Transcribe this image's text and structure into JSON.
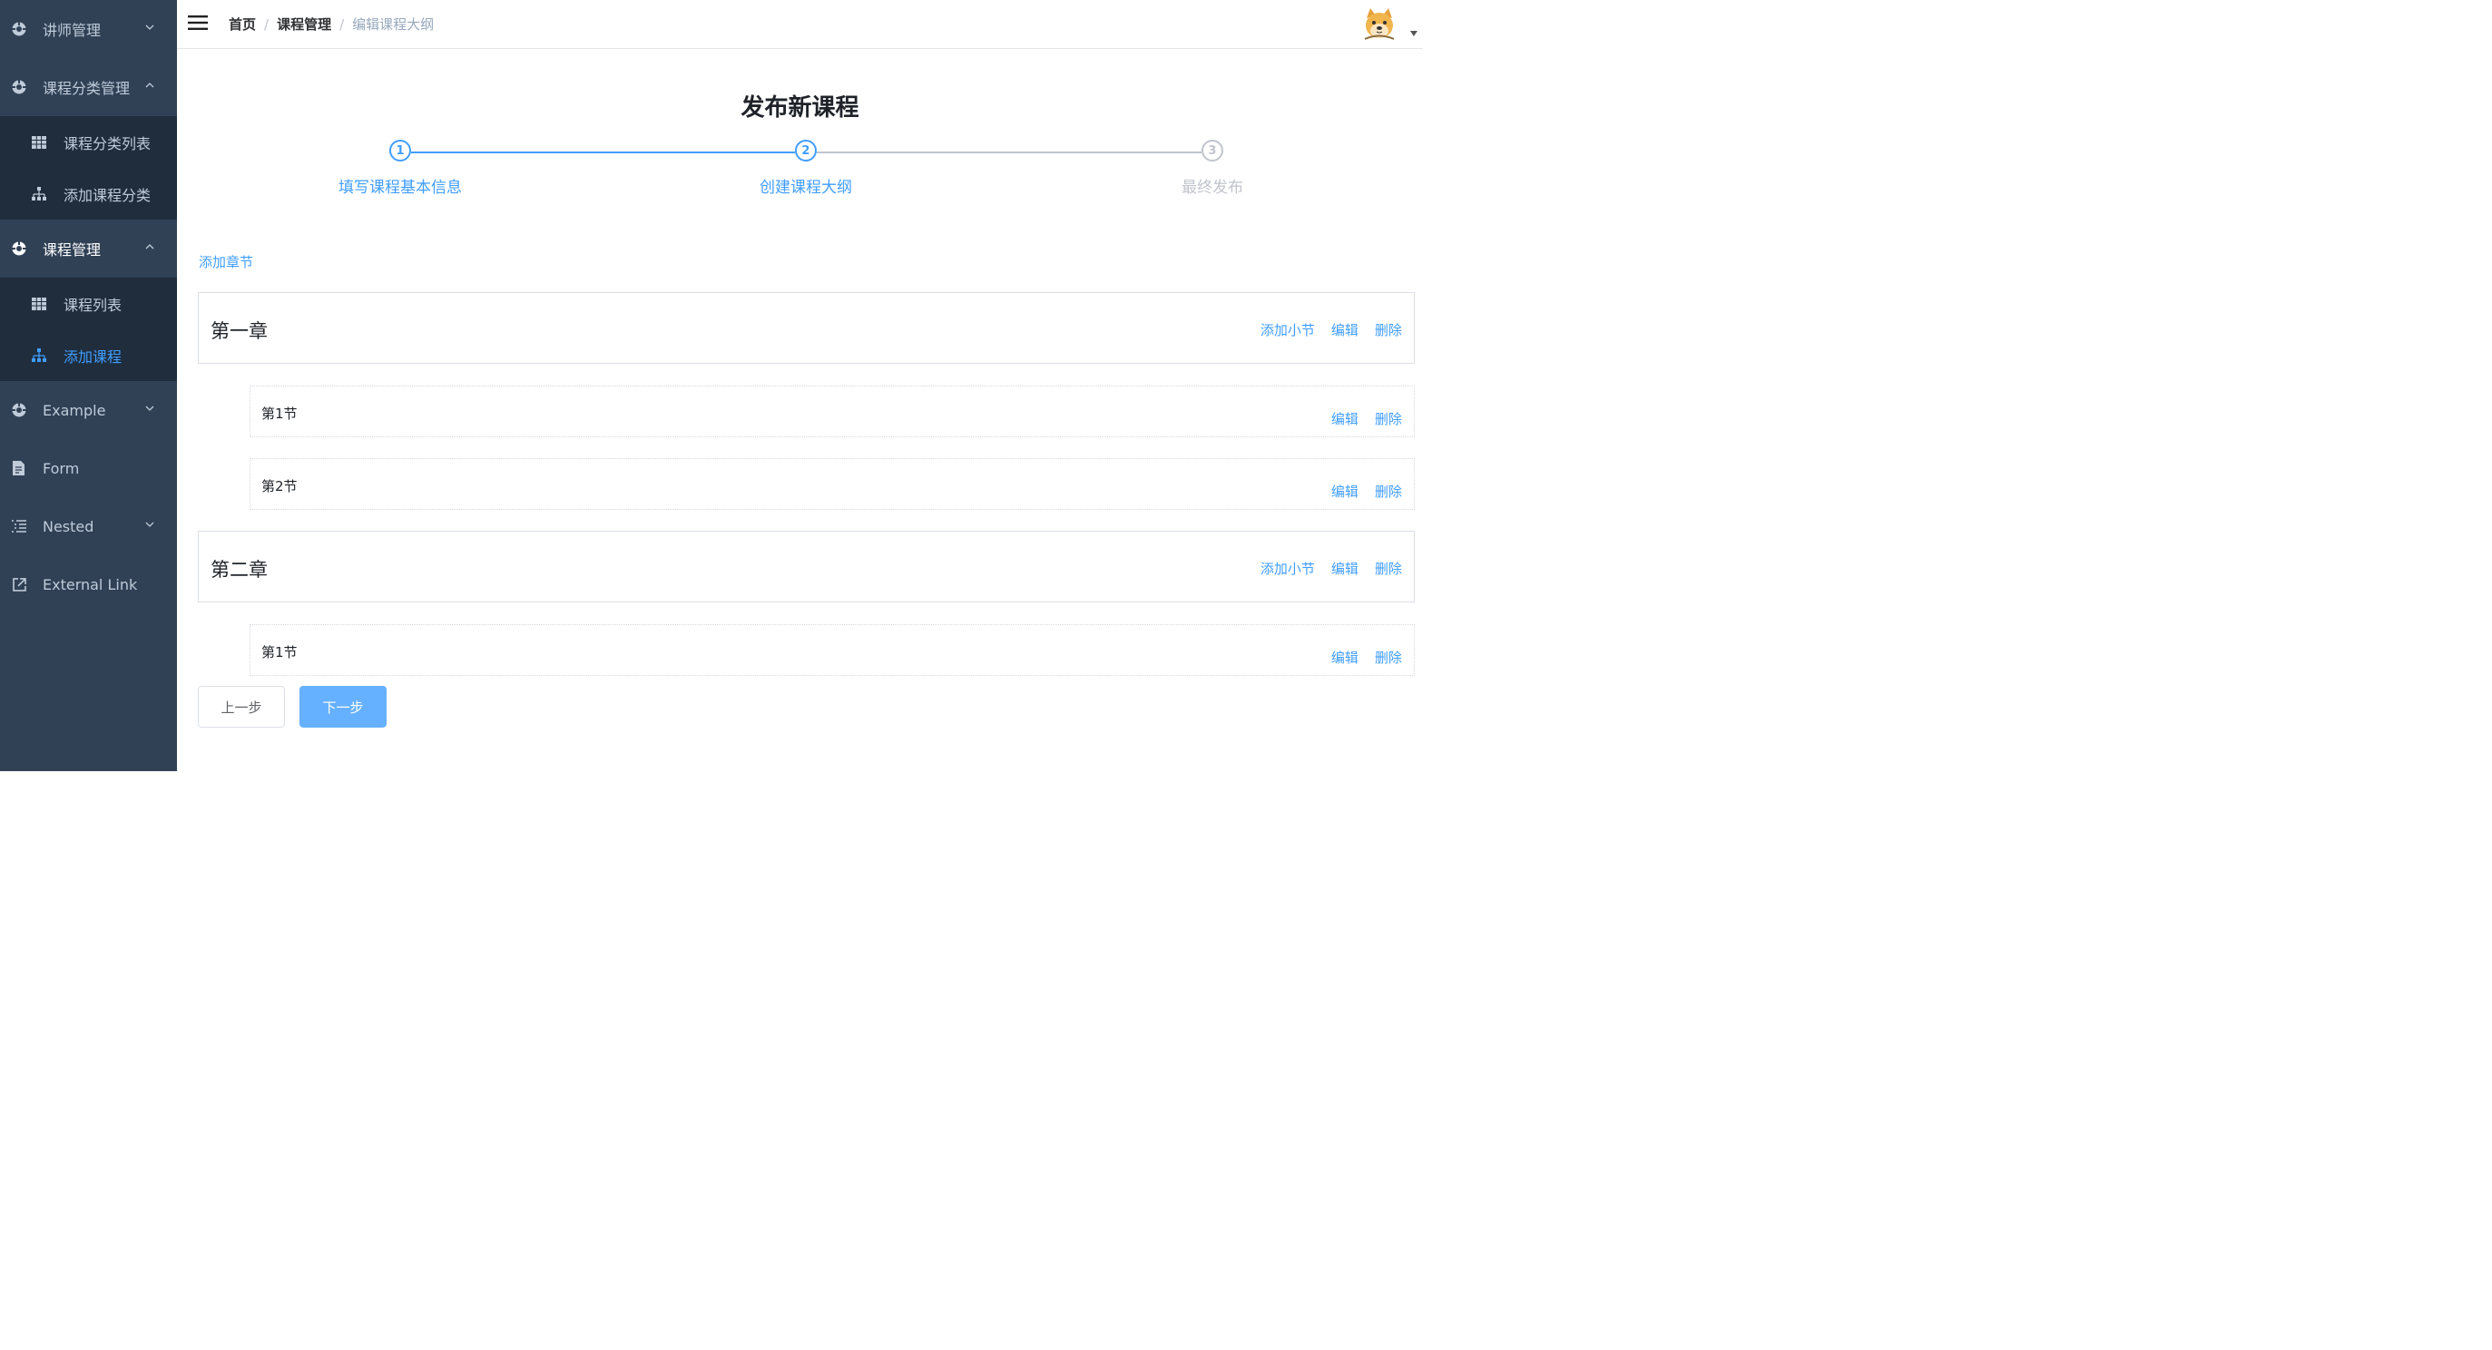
{
  "sidebar": {
    "menu": [
      {
        "label": "讲师管理",
        "icon": "gear-icon",
        "expandable": true,
        "expanded": false
      },
      {
        "label": "课程分类管理",
        "icon": "gear-icon",
        "expandable": true,
        "expanded": true,
        "children": [
          {
            "label": "课程分类列表",
            "icon": "table-icon",
            "active": false
          },
          {
            "label": "添加课程分类",
            "icon": "tree-icon",
            "active": false
          }
        ]
      },
      {
        "label": "课程管理",
        "icon": "gear-icon",
        "expandable": true,
        "expanded": true,
        "children": [
          {
            "label": "课程列表",
            "icon": "table-icon",
            "active": false
          },
          {
            "label": "添加课程",
            "icon": "tree-icon",
            "active": true
          }
        ]
      },
      {
        "label": "Example",
        "icon": "gear-icon",
        "expandable": true,
        "expanded": false
      },
      {
        "label": "Form",
        "icon": "form-icon",
        "expandable": false
      },
      {
        "label": "Nested",
        "icon": "nested-list-icon",
        "expandable": true,
        "expanded": false
      },
      {
        "label": "External Link",
        "icon": "external-link-icon",
        "expandable": false
      }
    ]
  },
  "navbar": {
    "breadcrumb": [
      "首页",
      "课程管理",
      "编辑课程大纲"
    ],
    "separator": "/"
  },
  "page": {
    "title": "发布新课程",
    "steps": [
      {
        "number": "1",
        "title": "填写课程基本信息",
        "status": "finished"
      },
      {
        "number": "2",
        "title": "创建课程大纲",
        "status": "active"
      },
      {
        "number": "3",
        "title": "最终发布",
        "status": "waiting"
      }
    ],
    "add_chapter_label": "添加章节",
    "chapters": [
      {
        "title": "第一章",
        "add_section": "添加小节",
        "edit": "编辑",
        "delete": "删除",
        "sections": [
          {
            "title": "第1节",
            "edit": "编辑",
            "delete": "删除"
          },
          {
            "title": "第2节",
            "edit": "编辑",
            "delete": "删除"
          }
        ]
      },
      {
        "title": "第二章",
        "add_section": "添加小节",
        "edit": "编辑",
        "delete": "删除",
        "sections": [
          {
            "title": "第1节",
            "edit": "编辑",
            "delete": "删除"
          }
        ]
      }
    ],
    "prev_button": "上一步",
    "next_button": "下一步"
  },
  "colors": {
    "sidebar_bg": "#304156",
    "submenu_bg": "#1f2d3d",
    "accent": "#409eff",
    "muted": "#c0c4cc"
  }
}
